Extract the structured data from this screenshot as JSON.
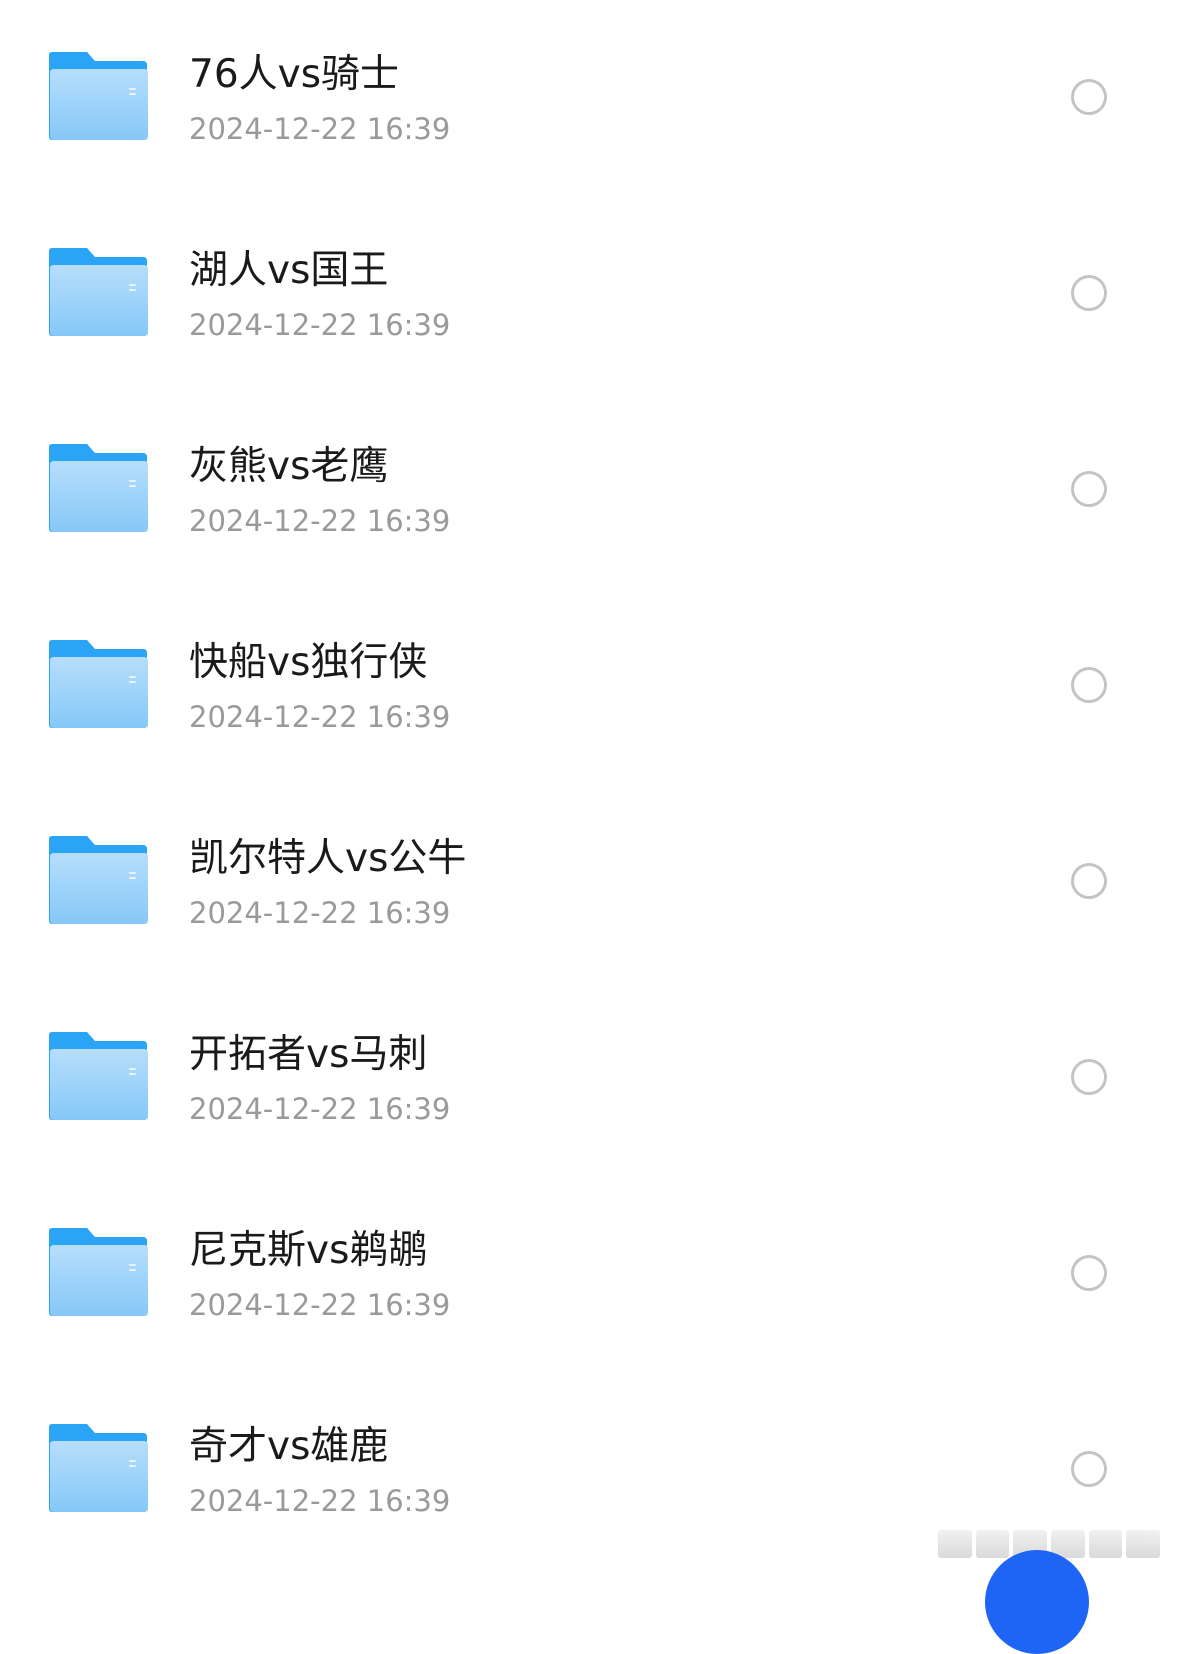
{
  "colors": {
    "folder_back": "#2aa5f5",
    "folder_front_top": "#b6defb",
    "folder_front_bottom": "#86c8f8",
    "name_text": "#1a1a1a",
    "date_text": "#9a9a9a",
    "radio_border": "#c4c4c4",
    "fab": "#1e64f5"
  },
  "files": [
    {
      "name": "76人vs骑士",
      "date": "2024-12-22 16:39",
      "icon": "folder-icon",
      "selected": false
    },
    {
      "name": "湖人vs国王",
      "date": "2024-12-22 16:39",
      "icon": "folder-icon",
      "selected": false
    },
    {
      "name": "灰熊vs老鹰",
      "date": "2024-12-22 16:39",
      "icon": "folder-icon",
      "selected": false
    },
    {
      "name": "快船vs独行侠",
      "date": "2024-12-22 16:39",
      "icon": "folder-icon",
      "selected": false
    },
    {
      "name": "凯尔特人vs公牛",
      "date": "2024-12-22 16:39",
      "icon": "folder-icon",
      "selected": false
    },
    {
      "name": "开拓者vs马刺",
      "date": "2024-12-22 16:39",
      "icon": "folder-icon",
      "selected": false
    },
    {
      "name": "尼克斯vs鹈鹕",
      "date": "2024-12-22 16:39",
      "icon": "folder-icon",
      "selected": false
    },
    {
      "name": "奇才vs雄鹿",
      "date": "2024-12-22 16:39",
      "icon": "folder-icon",
      "selected": false
    }
  ]
}
